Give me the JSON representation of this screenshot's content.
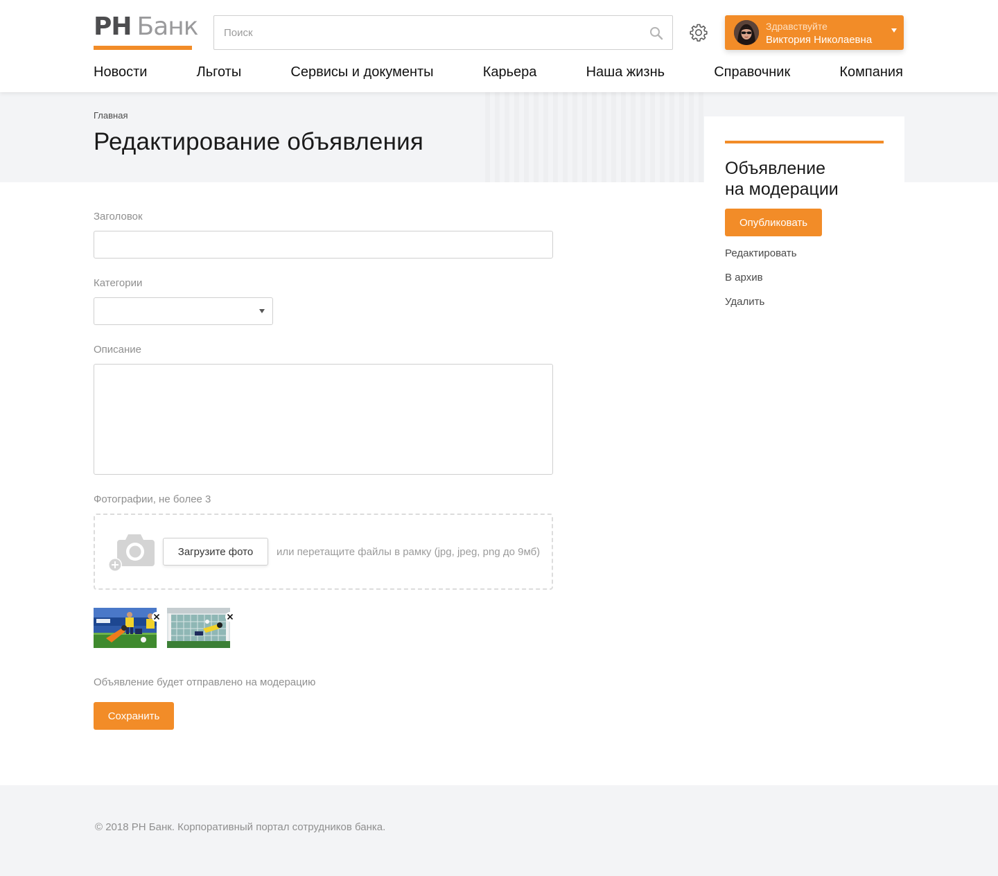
{
  "brand": {
    "logo_primary": "РН",
    "logo_secondary": "Банк",
    "accent_color": "#f28c28"
  },
  "search": {
    "placeholder": "Поиск",
    "icon": "search-icon"
  },
  "settings": {
    "icon": "gear-icon"
  },
  "user": {
    "greeting": "Здравствуйте",
    "name": "Виктория Николаевна",
    "icon": "chevron-down-icon"
  },
  "nav": {
    "items": [
      {
        "label": "Новости"
      },
      {
        "label": "Льготы"
      },
      {
        "label": "Сервисы и документы"
      },
      {
        "label": "Карьера"
      },
      {
        "label": "Наша жизнь"
      },
      {
        "label": "Справочник"
      },
      {
        "label": "Компания"
      }
    ]
  },
  "breadcrumb": {
    "home": "Главная"
  },
  "page": {
    "title": "Редактирование объявления"
  },
  "sidebar": {
    "title_line1": "Объявление",
    "title_line2": "на модерации",
    "publish_label": "Опубликовать",
    "links": [
      {
        "label": "Редактировать"
      },
      {
        "label": "В архив"
      },
      {
        "label": "Удалить"
      }
    ]
  },
  "form": {
    "title_label": "Заголовок",
    "title_value": "",
    "category_label": "Категории",
    "category_value": "",
    "description_label": "Описание",
    "description_value": "",
    "photos_label": "Фотографии, не более 3",
    "upload_label": "Загрузите фото",
    "drop_hint": "или перетащите файлы в рамку (jpg, jpeg, png до 9мб)",
    "camera_icon": "camera-add-icon",
    "photos": [
      {
        "name": "photo-1",
        "remove_icon": "close-icon"
      },
      {
        "name": "photo-2",
        "remove_icon": "close-icon"
      }
    ],
    "moderation_note": "Объявление будет отправлено на модерацию",
    "save_label": "Сохранить"
  },
  "footer": {
    "copyright": "© 2018 РН Банк. Корпоративный портал сотрудников банка."
  }
}
